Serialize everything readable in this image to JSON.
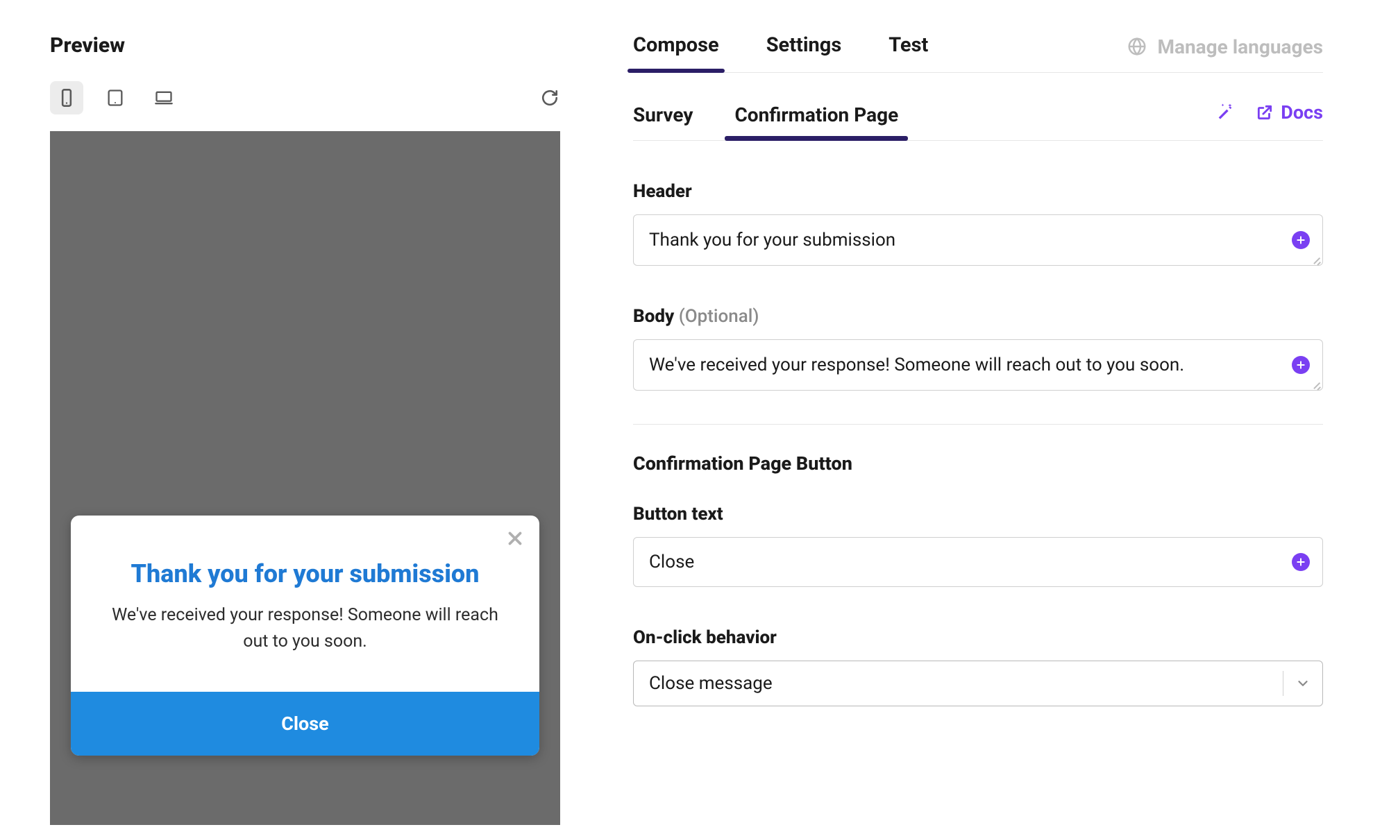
{
  "preview": {
    "title": "Preview",
    "devices": [
      "phone",
      "tablet",
      "desktop"
    ],
    "active_device": "phone",
    "survey_header": "Thank you for your submission",
    "survey_body": "We've received your response! Someone will reach out to you soon.",
    "survey_button": "Close"
  },
  "top_tabs": {
    "items": [
      "Compose",
      "Settings",
      "Test"
    ],
    "active": "Compose",
    "manage_languages": "Manage languages"
  },
  "sub_tabs": {
    "items": [
      "Survey",
      "Confirmation Page"
    ],
    "active": "Confirmation Page",
    "docs": "Docs"
  },
  "form": {
    "header_label": "Header",
    "header_value": "Thank you for your submission",
    "body_label": "Body",
    "body_optional": "(Optional)",
    "body_value": "We've received your response! Someone will reach out to you soon.",
    "button_section_title": "Confirmation Page Button",
    "button_text_label": "Button text",
    "button_text_value": "Close",
    "onclick_label": "On-click behavior",
    "onclick_value": "Close message"
  }
}
